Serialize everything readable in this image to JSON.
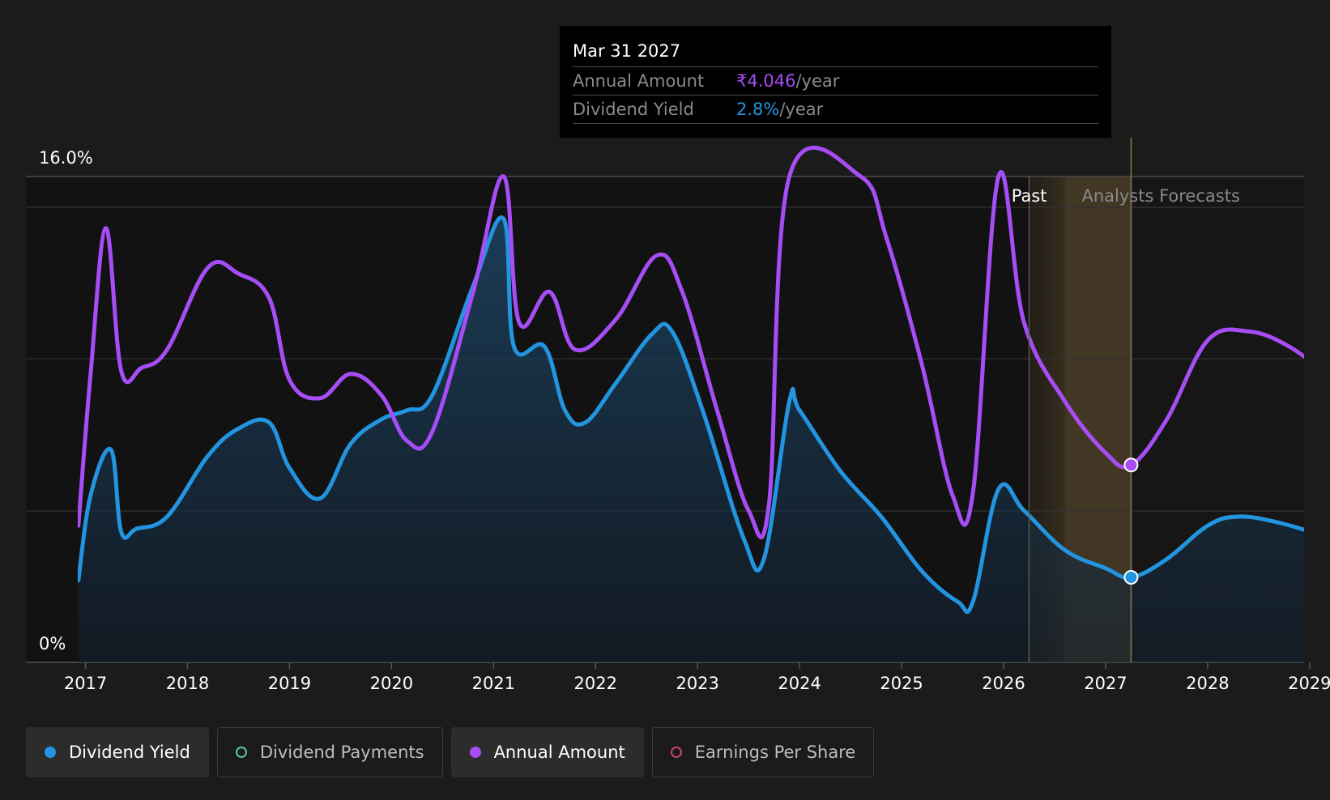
{
  "tooltip": {
    "date": "Mar 31 2027",
    "rows": [
      {
        "label": "Annual Amount",
        "value": "₹4.046",
        "unit": "/year",
        "color": "#a64df5"
      },
      {
        "label": "Dividend Yield",
        "value": "2.8%",
        "unit": "/year",
        "color": "#2394df"
      }
    ]
  },
  "region_labels": {
    "past": "Past",
    "forecast": "Analysts Forecasts"
  },
  "legend": [
    {
      "label": "Dividend Yield",
      "color": "#2394df",
      "filled": true,
      "active": true
    },
    {
      "label": "Dividend Payments",
      "color": "#58c2b2",
      "filled": false,
      "active": false
    },
    {
      "label": "Annual Amount",
      "color": "#a64df5",
      "filled": true,
      "active": true
    },
    {
      "label": "Earnings Per Share",
      "color": "#c0447c",
      "filled": false,
      "active": false
    }
  ],
  "chart_data": {
    "type": "line",
    "title": "",
    "xlabel": "",
    "ylabel": "",
    "y_tick_labels": [
      "16.0%",
      "0%"
    ],
    "ylim": [
      0,
      16
    ],
    "xlim": [
      2016.4,
      2029.2
    ],
    "x_ticks": [
      2017,
      2018,
      2019,
      2020,
      2021,
      2022,
      2023,
      2024,
      2025,
      2026,
      2027,
      2028,
      2029
    ],
    "past_end": 2026.25,
    "forecast_start": 2026.6,
    "tooltip_x": 2027.25,
    "grid": true,
    "series": [
      {
        "name": "Dividend Yield",
        "color": "#2394df",
        "fill": true,
        "points": [
          [
            2016.93,
            2.7
          ],
          [
            2017.05,
            5.5
          ],
          [
            2017.25,
            7.0
          ],
          [
            2017.35,
            4.3
          ],
          [
            2017.5,
            4.4
          ],
          [
            2017.8,
            4.8
          ],
          [
            2018.2,
            6.8
          ],
          [
            2018.5,
            7.7
          ],
          [
            2018.8,
            7.9
          ],
          [
            2019.0,
            6.4
          ],
          [
            2019.3,
            5.4
          ],
          [
            2019.6,
            7.2
          ],
          [
            2019.9,
            8.0
          ],
          [
            2020.15,
            8.3
          ],
          [
            2020.4,
            8.8
          ],
          [
            2020.8,
            12.4
          ],
          [
            2021.1,
            14.6
          ],
          [
            2021.2,
            10.4
          ],
          [
            2021.5,
            10.4
          ],
          [
            2021.7,
            8.3
          ],
          [
            2021.9,
            7.9
          ],
          [
            2022.2,
            9.2
          ],
          [
            2022.55,
            10.8
          ],
          [
            2022.75,
            10.9
          ],
          [
            2023.05,
            8.3
          ],
          [
            2023.45,
            4.1
          ],
          [
            2023.65,
            3.4
          ],
          [
            2023.9,
            8.6
          ],
          [
            2024.0,
            8.3
          ],
          [
            2024.4,
            6.3
          ],
          [
            2024.8,
            4.8
          ],
          [
            2025.2,
            3.0
          ],
          [
            2025.55,
            2.0
          ],
          [
            2025.7,
            2.0
          ],
          [
            2025.95,
            5.7
          ],
          [
            2026.2,
            5.0
          ],
          [
            2026.6,
            3.7
          ],
          [
            2027.0,
            3.1
          ],
          [
            2027.25,
            2.8
          ],
          [
            2027.6,
            3.4
          ],
          [
            2028.0,
            4.5
          ],
          [
            2028.3,
            4.8
          ],
          [
            2028.7,
            4.6
          ],
          [
            2029.2,
            4.1
          ]
        ]
      },
      {
        "name": "Annual Amount",
        "color": "#a64df5",
        "fill": false,
        "points": [
          [
            2016.93,
            4.5
          ],
          [
            2017.05,
            9.5
          ],
          [
            2017.2,
            14.3
          ],
          [
            2017.35,
            9.6
          ],
          [
            2017.55,
            9.7
          ],
          [
            2017.8,
            10.3
          ],
          [
            2018.2,
            13.0
          ],
          [
            2018.5,
            12.8
          ],
          [
            2018.8,
            12.0
          ],
          [
            2019.0,
            9.3
          ],
          [
            2019.3,
            8.7
          ],
          [
            2019.6,
            9.5
          ],
          [
            2019.9,
            8.8
          ],
          [
            2020.15,
            7.3
          ],
          [
            2020.4,
            7.6
          ],
          [
            2020.8,
            12.2
          ],
          [
            2021.1,
            16.0
          ],
          [
            2021.25,
            11.2
          ],
          [
            2021.55,
            12.2
          ],
          [
            2021.8,
            10.3
          ],
          [
            2022.2,
            11.3
          ],
          [
            2022.6,
            13.4
          ],
          [
            2022.85,
            12.2
          ],
          [
            2023.2,
            8.2
          ],
          [
            2023.5,
            5.0
          ],
          [
            2023.7,
            5.2
          ],
          [
            2023.9,
            16.0
          ],
          [
            2024.6,
            16.0
          ],
          [
            2024.85,
            14.0
          ],
          [
            2025.2,
            9.8
          ],
          [
            2025.5,
            5.5
          ],
          [
            2025.7,
            5.6
          ],
          [
            2025.95,
            16.0
          ],
          [
            2026.2,
            11.2
          ],
          [
            2026.6,
            8.6
          ],
          [
            2027.0,
            6.9
          ],
          [
            2027.25,
            6.5
          ],
          [
            2027.6,
            8.0
          ],
          [
            2028.0,
            10.6
          ],
          [
            2028.4,
            10.9
          ],
          [
            2028.8,
            10.4
          ],
          [
            2029.2,
            9.4
          ]
        ]
      }
    ]
  }
}
